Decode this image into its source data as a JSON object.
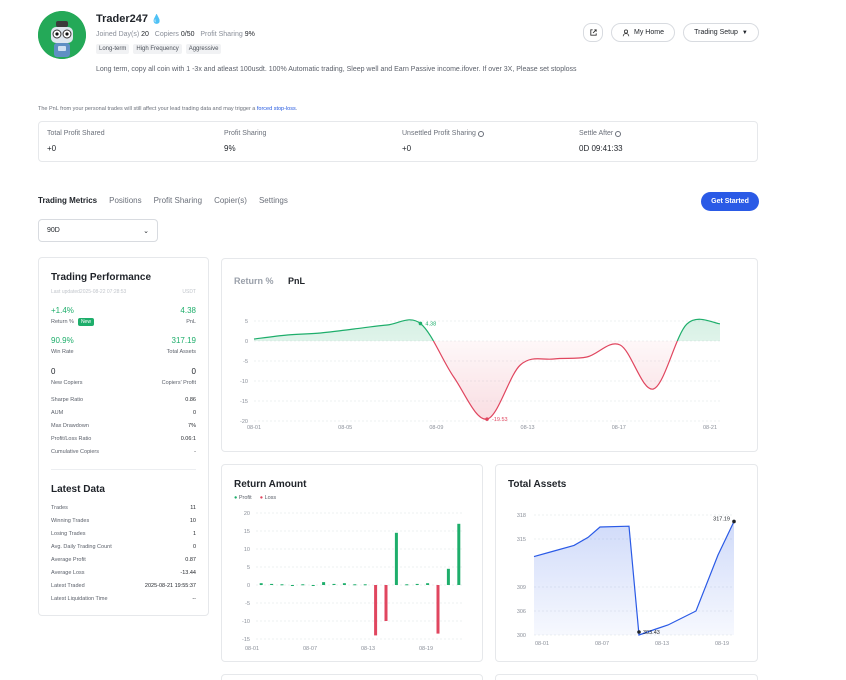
{
  "profile": {
    "name": "Trader247",
    "joined_label": "Joined Day(s)",
    "joined_value": "20",
    "copiers_label": "Copiers",
    "copiers_value": "0/50",
    "profit_sharing_label": "Profit Sharing",
    "profit_sharing_value": "9%",
    "tags": [
      "Long-term",
      "High Frequency",
      "Aggressive"
    ],
    "description": "Long term, copy all coin with 1 -3x and atleast 100usdt. 100% Automatic trading, Sleep well and Earn Passive income.ifover. If over 3X, Please set stoploss"
  },
  "header_buttons": {
    "my_home": "My Home",
    "trading_setup": "Trading Setup"
  },
  "notice": {
    "text": "The PnL from your personal trades will still affect your lead trading data and may trigger a ",
    "link": "forced stop-loss",
    "end": "."
  },
  "summary": [
    {
      "label": "Total Profit Shared",
      "value": "+0",
      "info": false
    },
    {
      "label": "Profit Sharing",
      "value": "9%",
      "info": false
    },
    {
      "label": "Unsettled Profit Sharing",
      "value": "+0",
      "info": true
    },
    {
      "label": "Settle After",
      "value": "0D 09:41:33",
      "info": true
    }
  ],
  "tabs": [
    "Trading Metrics",
    "Positions",
    "Profit Sharing",
    "Copier(s)",
    "Settings"
  ],
  "get_started": "Get Started",
  "period_select": "90D",
  "performance": {
    "title": "Trading Performance",
    "updated": "Last updated2025-08-22 07:28:53",
    "unit": "USDT",
    "return_value": "+1.4%",
    "return_label": "Return %",
    "new_badge": "New",
    "pnl_value": "4.38",
    "pnl_label": "PnL",
    "win_rate_value": "90.9%",
    "win_rate_label": "Win Rate",
    "total_assets_value": "317.19",
    "total_assets_label": "Total Assets",
    "new_copiers_value": "0",
    "new_copiers_label": "New Copiers",
    "copiers_profit_value": "0",
    "copiers_profit_label": "Copiers' Profit",
    "stats": [
      {
        "k": "Sharpe Ratio",
        "v": "0.86"
      },
      {
        "k": "AUM",
        "v": "0"
      },
      {
        "k": "Max Drawdown",
        "v": "7%"
      },
      {
        "k": "Profit/Loss Ratio",
        "v": "0.06:1"
      },
      {
        "k": "Cumulative Copiers",
        "v": "-"
      }
    ]
  },
  "latest": {
    "title": "Latest Data",
    "rows": [
      {
        "k": "Trades",
        "v": "11"
      },
      {
        "k": "Winning Trades",
        "v": "10"
      },
      {
        "k": "Losing Trades",
        "v": "1"
      },
      {
        "k": "Avg. Daily Trading Count",
        "v": "0"
      },
      {
        "k": "Average Profit",
        "v": "0.87"
      },
      {
        "k": "Average Loss",
        "v": "-13.44"
      },
      {
        "k": "Latest Traded",
        "v": "2025-08-21 19:55:37"
      },
      {
        "k": "Latest Liquidation Time",
        "v": "--"
      }
    ]
  },
  "return_chart": {
    "tab_return": "Return %",
    "tab_pnl": "PnL",
    "chart_data": {
      "type": "area",
      "x": [
        "08-01",
        "08-03",
        "08-05",
        "08-07",
        "08-09",
        "08-11",
        "08-12",
        "08-13",
        "08-14",
        "08-15",
        "08-17",
        "08-19",
        "08-20",
        "08-21",
        "08-22"
      ],
      "yticks": [
        5,
        0,
        -5,
        -10,
        -15,
        -20
      ],
      "xticks": [
        "08-01",
        "08-05",
        "08-09",
        "08-13",
        "08-17",
        "08-21"
      ],
      "values": [
        0.5,
        1.5,
        2,
        3,
        4,
        4.38,
        -9,
        -19.53,
        -6,
        -4.5,
        -4,
        -1,
        -12,
        4.2,
        4.3
      ],
      "ylim": [
        -20,
        6
      ],
      "labels": [
        "4.38",
        "-19.53"
      ],
      "colors": {
        "positive": "#1eae6b",
        "negative": "#e0465f"
      }
    }
  },
  "return_amount": {
    "title": "Return Amount",
    "legend_profit": "Profit",
    "legend_loss": "Loss",
    "chart_data": {
      "type": "bar",
      "yticks": [
        20,
        15,
        10,
        5,
        0,
        -5,
        -10,
        -15
      ],
      "xticks": [
        "08-01",
        "08-07",
        "08-13",
        "08-19"
      ],
      "ylim": [
        -15,
        20
      ],
      "values": [
        0.5,
        0.3,
        0.2,
        0,
        0.2,
        0,
        0.8,
        0.3,
        0.5,
        0.2,
        0.2,
        -14,
        -10,
        14.5,
        0.2,
        0.3,
        0.5,
        -13.5,
        4.5,
        17
      ],
      "colors": {
        "profit": "#1eae6b",
        "loss": "#e0465f"
      }
    }
  },
  "total_assets": {
    "title": "Total Assets",
    "chart_data": {
      "type": "area",
      "yticks": [
        "318",
        "315",
        "309",
        "306",
        "300"
      ],
      "xticks": [
        "08-01",
        "08-07",
        "08-13",
        "08-19"
      ],
      "values": [
        312.8,
        313.5,
        314.2,
        315.2,
        316.5,
        316.6,
        300,
        301.5,
        302.5,
        306,
        313,
        317.19
      ],
      "labels": [
        "317.19",
        "303.43"
      ],
      "color": "#2a5ae6"
    }
  }
}
